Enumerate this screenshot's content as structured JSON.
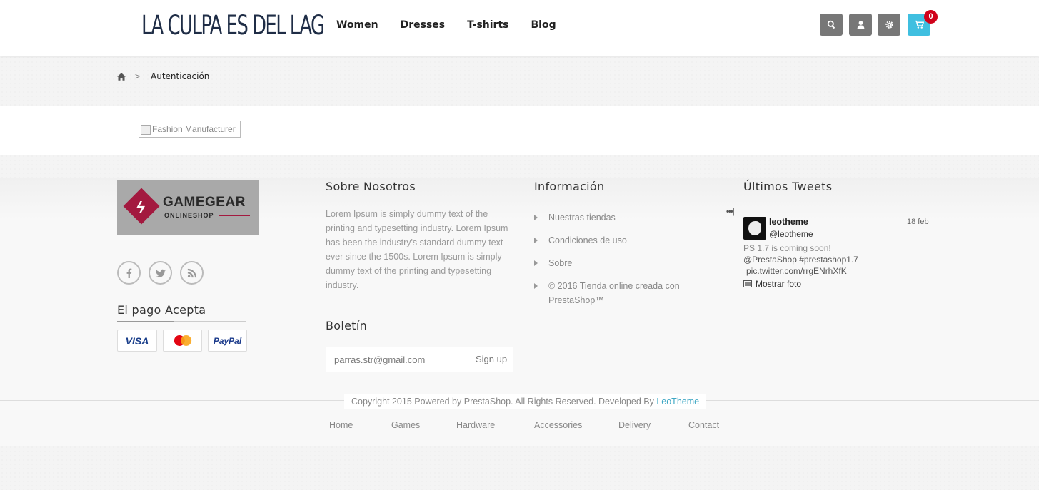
{
  "header": {
    "logo_text": "LA CULPA ES DEL LAG",
    "nav": [
      "Women",
      "Dresses",
      "T-shirts",
      "Blog"
    ],
    "cart_count": "0",
    "icons": [
      "search-icon",
      "user-icon",
      "gear-icon",
      "cart-icon"
    ]
  },
  "breadcrumb": {
    "separator": ">",
    "current": "Autenticación"
  },
  "manufacturer": {
    "alt": "Fashion Manufacturer"
  },
  "footer": {
    "logo": {
      "title": "GAMEGEAR",
      "subtitle": "ONLINESHOP"
    },
    "social": [
      "facebook-icon",
      "twitter-icon",
      "rss-icon"
    ],
    "payment_heading": "El pago Acepta",
    "payments": [
      "VISA",
      "PayPal"
    ],
    "about_heading": "Sobre Nosotros",
    "about_text": "Lorem Ipsum is simply dummy text of the printing and typesetting industry. Lorem Ipsum has been the industry's standard dummy text ever since the 1500s. Lorem Ipsum is simply dummy text of the printing and typesetting industry.",
    "newsletter_heading": "Boletín",
    "newsletter_value": "parras.str@gmail.com",
    "newsletter_button": "Sign up",
    "info_heading": "Información",
    "info_links": [
      "Nuestras tiendas",
      "Condiciones de uso",
      "Sobre",
      "© 2016 Tienda online creada con PrestaShop™"
    ],
    "tweets_heading": "Últimos Tweets",
    "tweet": {
      "name": "leotheme",
      "handle": "@leotheme",
      "date": "18 feb",
      "line1": "PS 1.7 is coming soon!",
      "line2": "@PrestaShop #prestashop1.7",
      "line3": "pic.twitter.com/rrgENrhXfK",
      "photo_link": "Mostrar foto"
    },
    "copyright_text": "Copyright 2015 Powered by PrestaShop. All Rights Reserved. Developed By ",
    "copyright_link": "LeoTheme",
    "bottom_nav": [
      "Home",
      "Games",
      "Hardware",
      "Accessories",
      "Delivery",
      "Contact"
    ]
  },
  "colors": {
    "accent": "#3fbfe0",
    "badge": "#d0021b",
    "brand": "#a3193f"
  }
}
